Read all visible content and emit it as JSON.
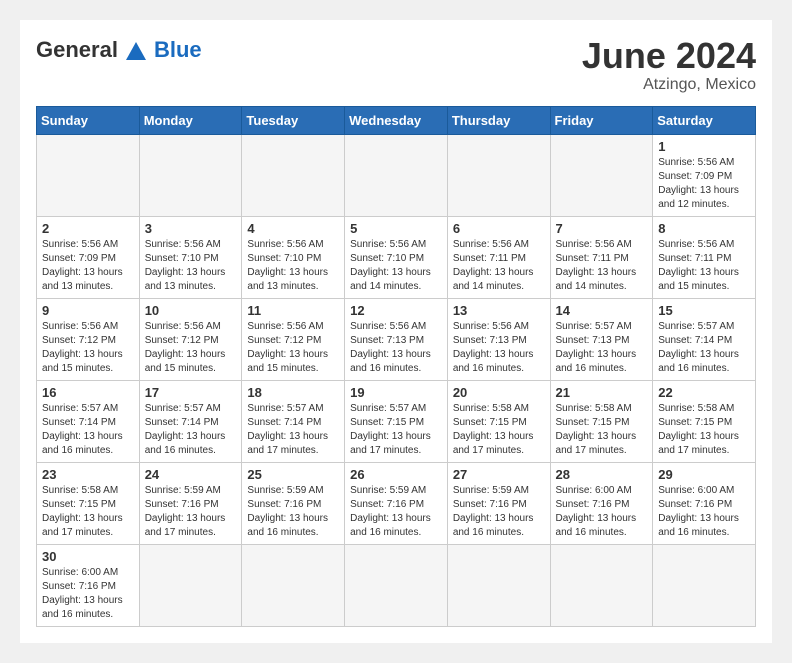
{
  "header": {
    "logo_general": "General",
    "logo_blue": "Blue",
    "month_year": "June 2024",
    "location": "Atzingo, Mexico"
  },
  "weekdays": [
    "Sunday",
    "Monday",
    "Tuesday",
    "Wednesday",
    "Thursday",
    "Friday",
    "Saturday"
  ],
  "weeks": [
    [
      {
        "day": "",
        "sunrise": "",
        "sunset": "",
        "daylight": "",
        "empty": true
      },
      {
        "day": "",
        "sunrise": "",
        "sunset": "",
        "daylight": "",
        "empty": true
      },
      {
        "day": "",
        "sunrise": "",
        "sunset": "",
        "daylight": "",
        "empty": true
      },
      {
        "day": "",
        "sunrise": "",
        "sunset": "",
        "daylight": "",
        "empty": true
      },
      {
        "day": "",
        "sunrise": "",
        "sunset": "",
        "daylight": "",
        "empty": true
      },
      {
        "day": "",
        "sunrise": "",
        "sunset": "",
        "daylight": "",
        "empty": true
      },
      {
        "day": "1",
        "sunrise": "Sunrise: 5:56 AM",
        "sunset": "Sunset: 7:09 PM",
        "daylight": "Daylight: 13 hours and 12 minutes.",
        "empty": false
      }
    ],
    [
      {
        "day": "2",
        "sunrise": "Sunrise: 5:56 AM",
        "sunset": "Sunset: 7:09 PM",
        "daylight": "Daylight: 13 hours and 13 minutes.",
        "empty": false
      },
      {
        "day": "3",
        "sunrise": "Sunrise: 5:56 AM",
        "sunset": "Sunset: 7:10 PM",
        "daylight": "Daylight: 13 hours and 13 minutes.",
        "empty": false
      },
      {
        "day": "4",
        "sunrise": "Sunrise: 5:56 AM",
        "sunset": "Sunset: 7:10 PM",
        "daylight": "Daylight: 13 hours and 13 minutes.",
        "empty": false
      },
      {
        "day": "5",
        "sunrise": "Sunrise: 5:56 AM",
        "sunset": "Sunset: 7:10 PM",
        "daylight": "Daylight: 13 hours and 14 minutes.",
        "empty": false
      },
      {
        "day": "6",
        "sunrise": "Sunrise: 5:56 AM",
        "sunset": "Sunset: 7:11 PM",
        "daylight": "Daylight: 13 hours and 14 minutes.",
        "empty": false
      },
      {
        "day": "7",
        "sunrise": "Sunrise: 5:56 AM",
        "sunset": "Sunset: 7:11 PM",
        "daylight": "Daylight: 13 hours and 14 minutes.",
        "empty": false
      },
      {
        "day": "8",
        "sunrise": "Sunrise: 5:56 AM",
        "sunset": "Sunset: 7:11 PM",
        "daylight": "Daylight: 13 hours and 15 minutes.",
        "empty": false
      }
    ],
    [
      {
        "day": "9",
        "sunrise": "Sunrise: 5:56 AM",
        "sunset": "Sunset: 7:12 PM",
        "daylight": "Daylight: 13 hours and 15 minutes.",
        "empty": false
      },
      {
        "day": "10",
        "sunrise": "Sunrise: 5:56 AM",
        "sunset": "Sunset: 7:12 PM",
        "daylight": "Daylight: 13 hours and 15 minutes.",
        "empty": false
      },
      {
        "day": "11",
        "sunrise": "Sunrise: 5:56 AM",
        "sunset": "Sunset: 7:12 PM",
        "daylight": "Daylight: 13 hours and 15 minutes.",
        "empty": false
      },
      {
        "day": "12",
        "sunrise": "Sunrise: 5:56 AM",
        "sunset": "Sunset: 7:13 PM",
        "daylight": "Daylight: 13 hours and 16 minutes.",
        "empty": false
      },
      {
        "day": "13",
        "sunrise": "Sunrise: 5:56 AM",
        "sunset": "Sunset: 7:13 PM",
        "daylight": "Daylight: 13 hours and 16 minutes.",
        "empty": false
      },
      {
        "day": "14",
        "sunrise": "Sunrise: 5:57 AM",
        "sunset": "Sunset: 7:13 PM",
        "daylight": "Daylight: 13 hours and 16 minutes.",
        "empty": false
      },
      {
        "day": "15",
        "sunrise": "Sunrise: 5:57 AM",
        "sunset": "Sunset: 7:14 PM",
        "daylight": "Daylight: 13 hours and 16 minutes.",
        "empty": false
      }
    ],
    [
      {
        "day": "16",
        "sunrise": "Sunrise: 5:57 AM",
        "sunset": "Sunset: 7:14 PM",
        "daylight": "Daylight: 13 hours and 16 minutes.",
        "empty": false
      },
      {
        "day": "17",
        "sunrise": "Sunrise: 5:57 AM",
        "sunset": "Sunset: 7:14 PM",
        "daylight": "Daylight: 13 hours and 16 minutes.",
        "empty": false
      },
      {
        "day": "18",
        "sunrise": "Sunrise: 5:57 AM",
        "sunset": "Sunset: 7:14 PM",
        "daylight": "Daylight: 13 hours and 17 minutes.",
        "empty": false
      },
      {
        "day": "19",
        "sunrise": "Sunrise: 5:57 AM",
        "sunset": "Sunset: 7:15 PM",
        "daylight": "Daylight: 13 hours and 17 minutes.",
        "empty": false
      },
      {
        "day": "20",
        "sunrise": "Sunrise: 5:58 AM",
        "sunset": "Sunset: 7:15 PM",
        "daylight": "Daylight: 13 hours and 17 minutes.",
        "empty": false
      },
      {
        "day": "21",
        "sunrise": "Sunrise: 5:58 AM",
        "sunset": "Sunset: 7:15 PM",
        "daylight": "Daylight: 13 hours and 17 minutes.",
        "empty": false
      },
      {
        "day": "22",
        "sunrise": "Sunrise: 5:58 AM",
        "sunset": "Sunset: 7:15 PM",
        "daylight": "Daylight: 13 hours and 17 minutes.",
        "empty": false
      }
    ],
    [
      {
        "day": "23",
        "sunrise": "Sunrise: 5:58 AM",
        "sunset": "Sunset: 7:15 PM",
        "daylight": "Daylight: 13 hours and 17 minutes.",
        "empty": false
      },
      {
        "day": "24",
        "sunrise": "Sunrise: 5:59 AM",
        "sunset": "Sunset: 7:16 PM",
        "daylight": "Daylight: 13 hours and 17 minutes.",
        "empty": false
      },
      {
        "day": "25",
        "sunrise": "Sunrise: 5:59 AM",
        "sunset": "Sunset: 7:16 PM",
        "daylight": "Daylight: 13 hours and 16 minutes.",
        "empty": false
      },
      {
        "day": "26",
        "sunrise": "Sunrise: 5:59 AM",
        "sunset": "Sunset: 7:16 PM",
        "daylight": "Daylight: 13 hours and 16 minutes.",
        "empty": false
      },
      {
        "day": "27",
        "sunrise": "Sunrise: 5:59 AM",
        "sunset": "Sunset: 7:16 PM",
        "daylight": "Daylight: 13 hours and 16 minutes.",
        "empty": false
      },
      {
        "day": "28",
        "sunrise": "Sunrise: 6:00 AM",
        "sunset": "Sunset: 7:16 PM",
        "daylight": "Daylight: 13 hours and 16 minutes.",
        "empty": false
      },
      {
        "day": "29",
        "sunrise": "Sunrise: 6:00 AM",
        "sunset": "Sunset: 7:16 PM",
        "daylight": "Daylight: 13 hours and 16 minutes.",
        "empty": false
      }
    ],
    [
      {
        "day": "30",
        "sunrise": "Sunrise: 6:00 AM",
        "sunset": "Sunset: 7:16 PM",
        "daylight": "Daylight: 13 hours and 16 minutes.",
        "empty": false
      },
      {
        "day": "",
        "sunrise": "",
        "sunset": "",
        "daylight": "",
        "empty": true
      },
      {
        "day": "",
        "sunrise": "",
        "sunset": "",
        "daylight": "",
        "empty": true
      },
      {
        "day": "",
        "sunrise": "",
        "sunset": "",
        "daylight": "",
        "empty": true
      },
      {
        "day": "",
        "sunrise": "",
        "sunset": "",
        "daylight": "",
        "empty": true
      },
      {
        "day": "",
        "sunrise": "",
        "sunset": "",
        "daylight": "",
        "empty": true
      },
      {
        "day": "",
        "sunrise": "",
        "sunset": "",
        "daylight": "",
        "empty": true
      }
    ]
  ]
}
